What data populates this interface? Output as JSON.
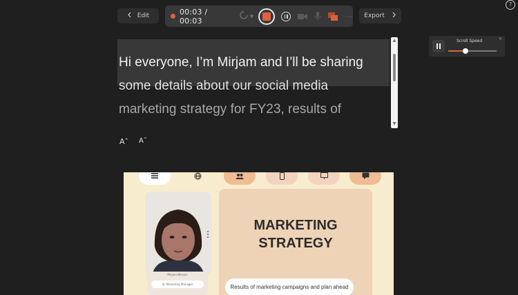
{
  "toolbar": {
    "edit_label": "Edit",
    "time": "00:03 / 00:03",
    "export_label": "Export",
    "help_label": "?"
  },
  "scroll_speed": {
    "title": "Scroll Speed",
    "level": 0.35
  },
  "script": {
    "lines": [
      "Hi everyone, I’m Mirjam and I’ll be sharing",
      "some details about our social media",
      "marketing strategy for FY23, results of"
    ],
    "font_increase": "Aˆ",
    "font_decrease": "Aˇ"
  },
  "preview": {
    "presenter_name": "Mirjam Nilsson",
    "presenter_role": "Sr. Marketing Manager",
    "slide_title_line1": "MARKETING",
    "slide_title_line2": "STRATEGY",
    "slide_subtitle": "Results of marketing campaigns and plan ahead"
  },
  "colors": {
    "background": "#1f1f1f",
    "accent": "#e0623b",
    "slide_bg": "#f7eccd",
    "slide_card": "#efd3b6"
  }
}
